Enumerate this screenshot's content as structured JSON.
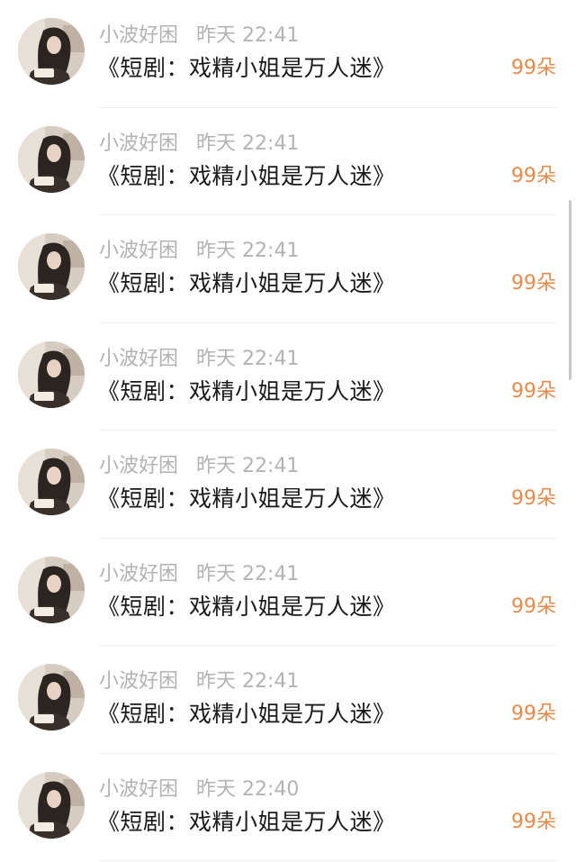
{
  "messages": [
    {
      "user": "小波好困",
      "day": "昨天",
      "time": "22:41",
      "title": "《短剧：戏精小姐是万人迷》",
      "gift": "99朵"
    },
    {
      "user": "小波好困",
      "day": "昨天",
      "time": "22:41",
      "title": "《短剧：戏精小姐是万人迷》",
      "gift": "99朵"
    },
    {
      "user": "小波好困",
      "day": "昨天",
      "time": "22:41",
      "title": "《短剧：戏精小姐是万人迷》",
      "gift": "99朵"
    },
    {
      "user": "小波好困",
      "day": "昨天",
      "time": "22:41",
      "title": "《短剧：戏精小姐是万人迷》",
      "gift": "99朵"
    },
    {
      "user": "小波好困",
      "day": "昨天",
      "time": "22:41",
      "title": "《短剧：戏精小姐是万人迷》",
      "gift": "99朵"
    },
    {
      "user": "小波好困",
      "day": "昨天",
      "time": "22:41",
      "title": "《短剧：戏精小姐是万人迷》",
      "gift": "99朵"
    },
    {
      "user": "小波好困",
      "day": "昨天",
      "time": "22:41",
      "title": "《短剧：戏精小姐是万人迷》",
      "gift": "99朵"
    },
    {
      "user": "小波好困",
      "day": "昨天",
      "time": "22:40",
      "title": "《短剧：戏精小姐是万人迷》",
      "gift": "99朵"
    }
  ],
  "colors": {
    "username": "#b3b3b3",
    "title": "#1a1a1a",
    "gift": "#e58b4b",
    "divider": "#f1f1f1"
  }
}
